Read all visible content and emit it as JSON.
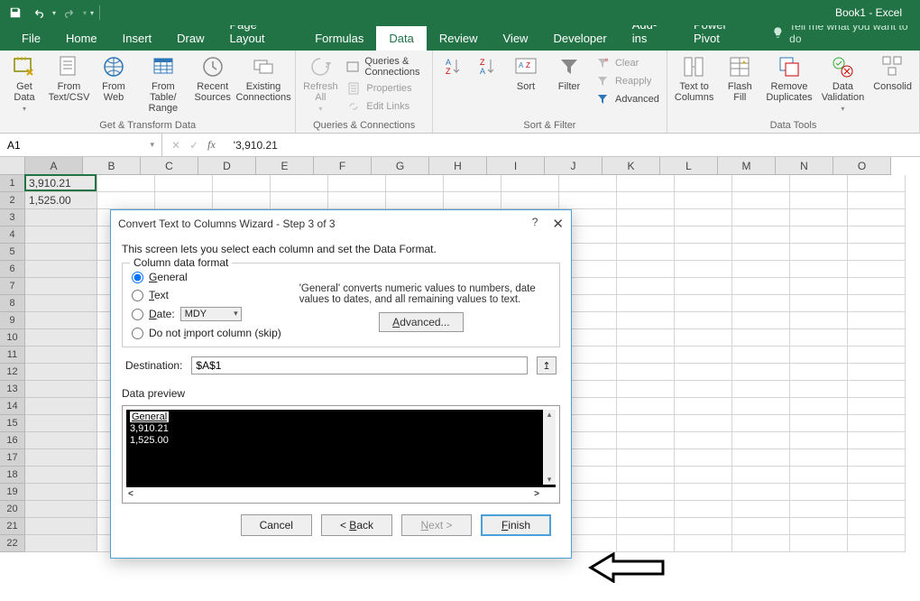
{
  "app": {
    "doc_title": "Book1",
    "suffix": "  -  Excel"
  },
  "tabs": [
    "File",
    "Home",
    "Insert",
    "Draw",
    "Page Layout",
    "Formulas",
    "Data",
    "Review",
    "View",
    "Developer",
    "Add-ins",
    "Power Pivot"
  ],
  "active_tab": "Data",
  "tellme": "Tell me what you want to do",
  "ribbon": {
    "get_data": "Get\nData",
    "from_textcsv": "From\nText/CSV",
    "from_web": "From\nWeb",
    "from_table": "From Table/\nRange",
    "recent_sources": "Recent\nSources",
    "existing_conn": "Existing\nConnections",
    "group_get": "Get & Transform Data",
    "refresh_all": "Refresh\nAll",
    "queries": "Queries & Connections",
    "properties": "Properties",
    "edit_links": "Edit Links",
    "group_queries": "Queries & Connections",
    "sort": "Sort",
    "filter": "Filter",
    "clear": "Clear",
    "reapply": "Reapply",
    "advanced": "Advanced",
    "group_sort": "Sort & Filter",
    "text_to_columns": "Text to\nColumns",
    "flash_fill": "Flash\nFill",
    "remove_dup": "Remove\nDuplicates",
    "data_val": "Data\nValidation",
    "consolidate": "Consolid",
    "group_tools": "Data Tools"
  },
  "namebox": "A1",
  "formula_value": "'3,910.21",
  "columns": [
    "A",
    "B",
    "C",
    "D",
    "E",
    "F",
    "G",
    "H",
    "I",
    "J",
    "K",
    "L",
    "M",
    "N",
    "O"
  ],
  "selected_col": "A",
  "rows_count": 22,
  "cells": {
    "A1": "3,910.21",
    "A2": "1,525.00"
  },
  "dialog": {
    "title": "Convert Text to Columns Wizard - Step 3 of 3",
    "desc": "This screen lets you select each column and set the Data Format.",
    "fieldset_legend": "Column data format",
    "opt_general": "General",
    "opt_text": "Text",
    "opt_date": "Date:",
    "date_value": "MDY",
    "opt_skip": "Do not import column (skip)",
    "format_desc": "'General' converts numeric values to numbers, date values to dates, and all remaining values to text.",
    "advanced": "Advanced...",
    "dest_label": "Destination:",
    "dest_value": "$A$1",
    "preview_label": "Data preview",
    "preview_header": "General",
    "preview_rows": [
      "3,910.21",
      "1,525.00"
    ],
    "btn_cancel": "Cancel",
    "btn_back": "< Back",
    "btn_next": "Next >",
    "btn_finish": "Finish"
  }
}
